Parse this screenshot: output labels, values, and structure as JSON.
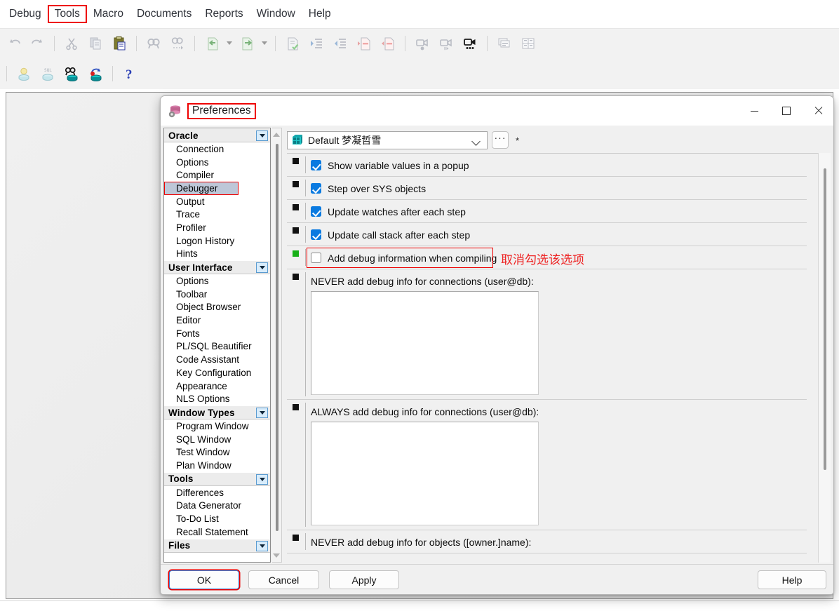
{
  "app": {
    "menubar": [
      {
        "label": "Debug",
        "highlighted": false
      },
      {
        "label": "Tools",
        "highlighted": true
      },
      {
        "label": "Macro",
        "highlighted": false
      },
      {
        "label": "Documents",
        "highlighted": false
      },
      {
        "label": "Reports",
        "highlighted": false
      },
      {
        "label": "Window",
        "highlighted": false
      },
      {
        "label": "Help",
        "highlighted": false
      }
    ],
    "toolbar_primary": [
      {
        "name": "undo-icon"
      },
      {
        "name": "redo-icon"
      },
      {
        "name": "separator"
      },
      {
        "name": "cut-icon"
      },
      {
        "name": "copy-icon"
      },
      {
        "name": "paste-icon"
      },
      {
        "name": "separator"
      },
      {
        "name": "find-icon"
      },
      {
        "name": "find-next-icon"
      },
      {
        "name": "separator"
      },
      {
        "name": "import-icon"
      },
      {
        "name": "import-dropdown-caret"
      },
      {
        "name": "export-icon"
      },
      {
        "name": "export-dropdown-caret"
      },
      {
        "name": "separator"
      },
      {
        "name": "check-syntax-icon"
      },
      {
        "name": "indent-icon"
      },
      {
        "name": "outdent-icon"
      },
      {
        "name": "comment-icon"
      },
      {
        "name": "uncomment-icon"
      },
      {
        "name": "separator"
      },
      {
        "name": "record-macro-icon"
      },
      {
        "name": "play-macro-icon"
      },
      {
        "name": "macro-library-icon"
      },
      {
        "name": "separator"
      },
      {
        "name": "cascade-windows-icon"
      },
      {
        "name": "tile-windows-icon"
      }
    ],
    "toolbar_secondary": [
      {
        "name": "separator"
      },
      {
        "name": "new-program-window-icon"
      },
      {
        "name": "new-sql-window-icon"
      },
      {
        "name": "browse-database-icon"
      },
      {
        "name": "rollback-icon"
      },
      {
        "name": "separator"
      },
      {
        "name": "help-question-icon"
      }
    ]
  },
  "dialog": {
    "title": "Preferences",
    "title_icon": "database-preferences-icon",
    "title_annotated": true,
    "window_controls": [
      {
        "name": "minimize-button",
        "glyph": "—"
      },
      {
        "name": "maximize-button",
        "glyph": "□"
      },
      {
        "name": "close-button",
        "glyph": "✕"
      }
    ],
    "profile": {
      "icon": "profile-gem-icon",
      "value": "Default 梦凝哲雪",
      "chevron": "chevron-down-icon",
      "ellipsis_label": "···",
      "modified_marker": "*"
    },
    "sidebar": {
      "groups": [
        {
          "label": "Oracle",
          "items": [
            {
              "label": "Connection",
              "selected": false,
              "annotated": false
            },
            {
              "label": "Options",
              "selected": false,
              "annotated": false
            },
            {
              "label": "Compiler",
              "selected": false,
              "annotated": false
            },
            {
              "label": "Debugger",
              "selected": true,
              "annotated": true
            },
            {
              "label": "Output",
              "selected": false,
              "annotated": false
            },
            {
              "label": "Trace",
              "selected": false,
              "annotated": false
            },
            {
              "label": "Profiler",
              "selected": false,
              "annotated": false
            },
            {
              "label": "Logon History",
              "selected": false,
              "annotated": false
            },
            {
              "label": "Hints",
              "selected": false,
              "annotated": false
            }
          ]
        },
        {
          "label": "User Interface",
          "items": [
            {
              "label": "Options",
              "selected": false,
              "annotated": false
            },
            {
              "label": "Toolbar",
              "selected": false,
              "annotated": false
            },
            {
              "label": "Object Browser",
              "selected": false,
              "annotated": false
            },
            {
              "label": "Editor",
              "selected": false,
              "annotated": false
            },
            {
              "label": "Fonts",
              "selected": false,
              "annotated": false
            },
            {
              "label": "PL/SQL Beautifier",
              "selected": false,
              "annotated": false
            },
            {
              "label": "Code Assistant",
              "selected": false,
              "annotated": false
            },
            {
              "label": "Key Configuration",
              "selected": false,
              "annotated": false
            },
            {
              "label": "Appearance",
              "selected": false,
              "annotated": false
            },
            {
              "label": "NLS Options",
              "selected": false,
              "annotated": false
            }
          ]
        },
        {
          "label": "Window Types",
          "items": [
            {
              "label": "Program Window",
              "selected": false,
              "annotated": false
            },
            {
              "label": "SQL Window",
              "selected": false,
              "annotated": false
            },
            {
              "label": "Test Window",
              "selected": false,
              "annotated": false
            },
            {
              "label": "Plan Window",
              "selected": false,
              "annotated": false
            }
          ]
        },
        {
          "label": "Tools",
          "items": [
            {
              "label": "Differences",
              "selected": false,
              "annotated": false
            },
            {
              "label": "Data Generator",
              "selected": false,
              "annotated": false
            },
            {
              "label": "To-Do List",
              "selected": false,
              "annotated": false
            },
            {
              "label": "Recall Statement",
              "selected": false,
              "annotated": false
            }
          ]
        },
        {
          "label": "Files",
          "items": []
        }
      ]
    },
    "options": [
      {
        "type": "checkbox",
        "label": "Show variable values in a popup",
        "checked": true,
        "marker": "black",
        "annotated": false
      },
      {
        "type": "checkbox",
        "label": "Step over SYS objects",
        "checked": true,
        "marker": "black",
        "annotated": false
      },
      {
        "type": "checkbox",
        "label": "Update watches after each step",
        "checked": true,
        "marker": "black",
        "annotated": false
      },
      {
        "type": "checkbox",
        "label": "Update call stack after each step",
        "checked": true,
        "marker": "black",
        "annotated": false
      },
      {
        "type": "checkbox",
        "label": "Add debug information when compiling",
        "checked": false,
        "marker": "green",
        "annotated": true,
        "annotation_text": "取消勾选该选项"
      },
      {
        "type": "textarea",
        "label": "NEVER add debug info for connections (user@db):",
        "value": "",
        "marker": "black",
        "annotated": false
      },
      {
        "type": "textarea",
        "label": "ALWAYS add debug info for connections (user@db):",
        "value": "",
        "marker": "black",
        "annotated": false
      },
      {
        "type": "label-only",
        "label": "NEVER add debug info for objects ([owner.]name):",
        "marker": "black",
        "annotated": false
      }
    ],
    "footer_buttons": [
      {
        "label": "OK",
        "focused": true,
        "annotated": true
      },
      {
        "label": "Cancel",
        "focused": false,
        "annotated": false
      },
      {
        "label": "Apply",
        "focused": false,
        "annotated": false
      },
      {
        "label": "Help",
        "focused": false,
        "annotated": false
      }
    ]
  },
  "colors": {
    "annotation_red": "#ee0000",
    "checkbox_blue": "#0a7ae0",
    "marker_green": "#18b018",
    "selection_blue": "#bdc7d8",
    "group_header_bg": "#ececec",
    "dialog_bg": "#f0f0f0"
  }
}
